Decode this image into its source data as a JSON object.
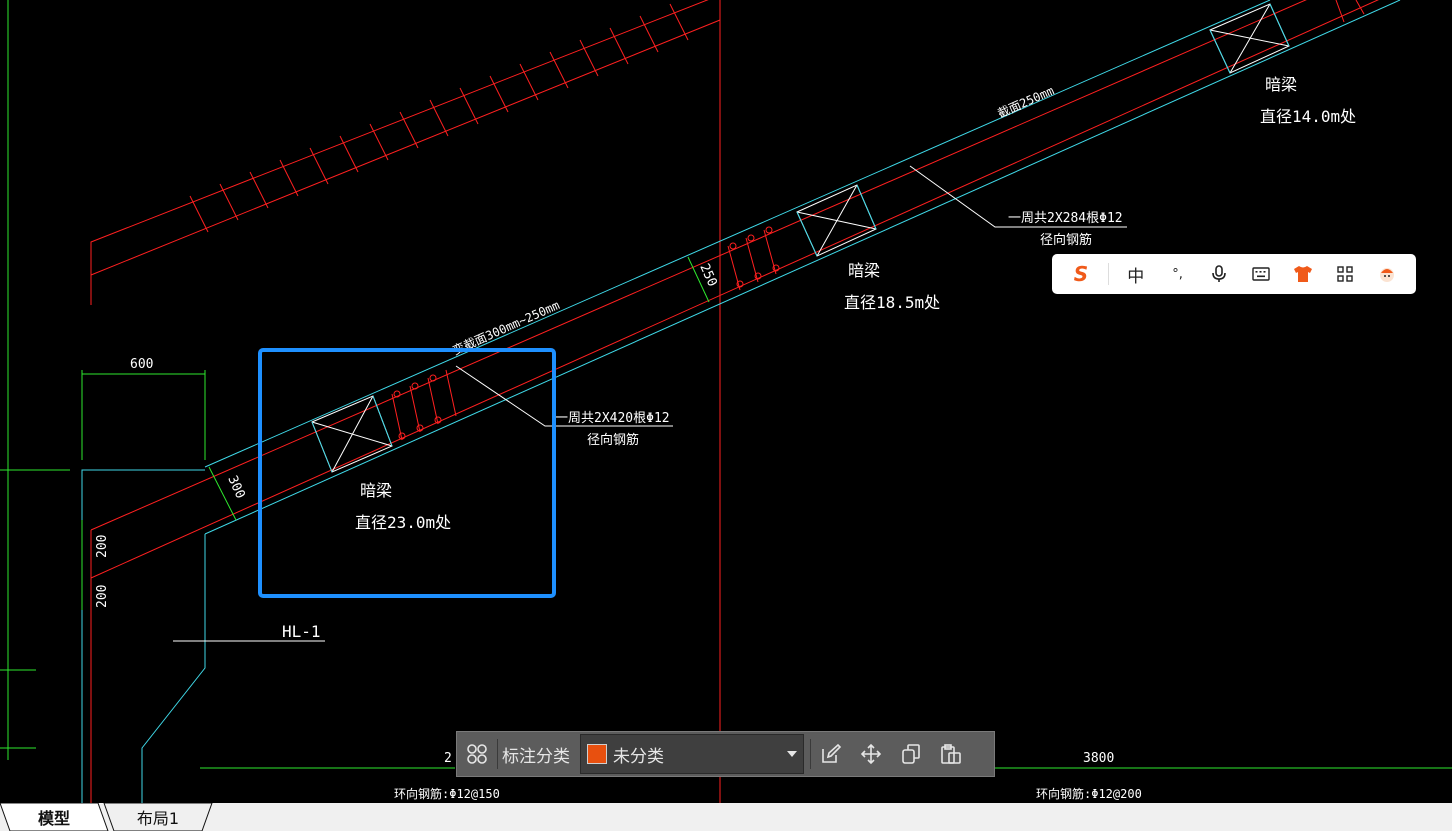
{
  "drawing": {
    "labels": {
      "ring_section_top": "截面250mm",
      "ring_section_lower": "变截面300mm~250mm",
      "hidden_beam_1": "暗梁",
      "hidden_beam_1_dia": "直径14.0m处",
      "hidden_beam_2": "暗梁",
      "hidden_beam_2_dia": "直径18.5m处",
      "hidden_beam_3": "暗梁",
      "hidden_beam_3_dia": "直径23.0m处",
      "rebar_upper": "一周共2X284根Φ12",
      "rebar_upper_sub": "径向钢筋",
      "rebar_lower": "一周共2X420根Φ12",
      "rebar_lower_sub": "径向钢筋",
      "dim_250": "250",
      "dim_300": "300",
      "dim_600": "600",
      "dim_200a": "200",
      "dim_200b": "200",
      "dim_3800": "3800",
      "dim_2x": "2",
      "beam_mark": "HL-1",
      "ring_rebar_left": "环向钢筋:Φ12@150",
      "ring_rebar_right": "环向钢筋:Φ12@200"
    },
    "colors": {
      "red": "#ff2020",
      "cyan": "#3fd9e8",
      "green": "#2ee82e",
      "white": "#ffffff",
      "highlight": "#1e90ff"
    }
  },
  "ime_toolbar": {
    "logo": "S",
    "mode": "中",
    "punct": "°,",
    "icons": [
      "sogou-logo-icon",
      "mic-icon",
      "keyboard-icon",
      "skin-icon",
      "grid-icon",
      "mascot-icon"
    ]
  },
  "annotation_toolbar": {
    "category_label": "标注分类",
    "category_value": "未分类",
    "category_color": "#e8500f"
  },
  "tabs": [
    {
      "label": "模型",
      "active": true
    },
    {
      "label": "布局1",
      "active": false
    }
  ]
}
